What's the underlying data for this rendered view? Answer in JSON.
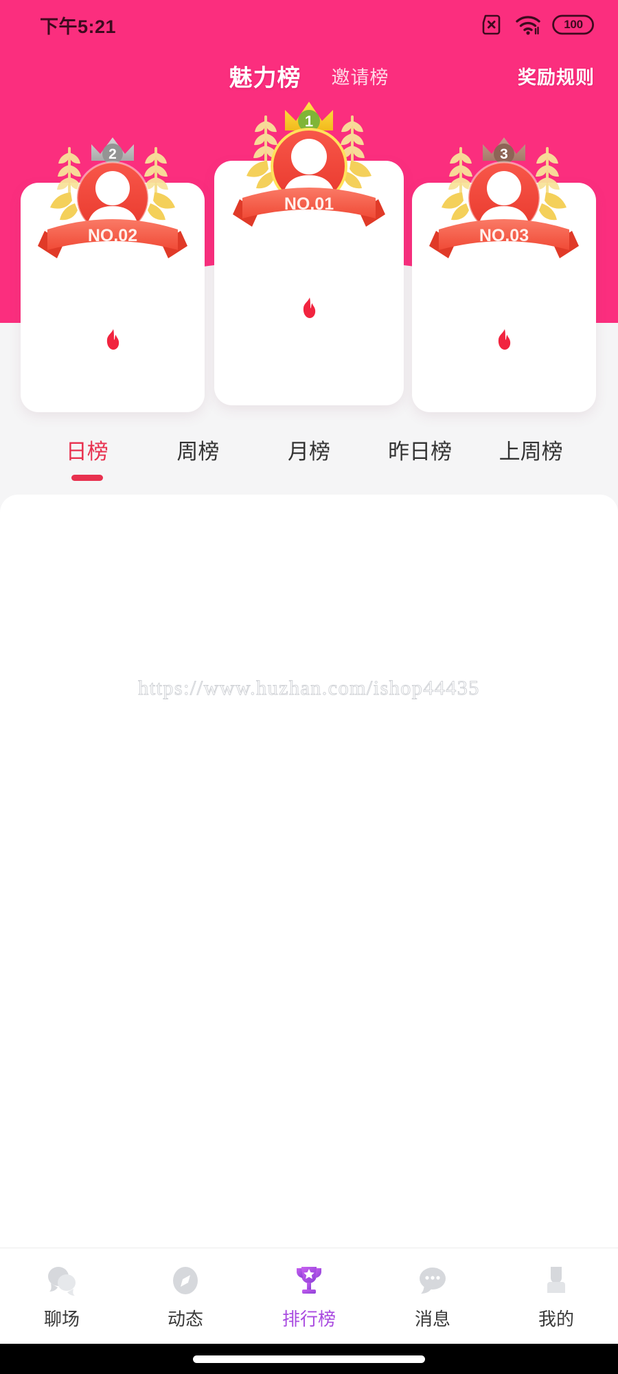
{
  "statusbar": {
    "time": "下午5:21",
    "sim_icon": "sim-card-disabled-icon",
    "wifi_icon": "wifi-icon",
    "battery_icon": "battery-icon",
    "battery_level": "100"
  },
  "header": {
    "tabs": [
      {
        "label": "魅力榜",
        "active": true
      },
      {
        "label": "邀请榜",
        "active": false
      }
    ],
    "rules_label": "奖励规则",
    "background_color": "#FB2E7E"
  },
  "podium": {
    "cards": [
      {
        "rank": "1",
        "ribbon": "NO.01",
        "crown_color": "#F7D228",
        "badge_color": "#7FB537",
        "avatar_ring_color": "#F4483C",
        "flame_icon": "flame-icon"
      },
      {
        "rank": "2",
        "ribbon": "NO.02",
        "crown_color": "#BFBFBF",
        "badge_color": "#8C8C8C",
        "avatar_ring_color": "#F4483C",
        "flame_icon": "flame-icon"
      },
      {
        "rank": "3",
        "ribbon": "NO.03",
        "crown_color": "#B38A7C",
        "badge_color": "#9A6E60",
        "avatar_ring_color": "#F4483C",
        "flame_icon": "flame-icon"
      }
    ]
  },
  "range_tabs": {
    "active_color": "#E8314F",
    "items": [
      {
        "label": "日榜",
        "active": true
      },
      {
        "label": "周榜",
        "active": false
      },
      {
        "label": "月榜",
        "active": false
      },
      {
        "label": "昨日榜",
        "active": false
      },
      {
        "label": "上周榜",
        "active": false
      }
    ]
  },
  "list_panel": {
    "watermark": "https://www.huzhan.com/ishop44435",
    "rows": []
  },
  "bottomnav": {
    "active_color": "#A94BE0",
    "items": [
      {
        "label": "聊场",
        "icon": "chat-rooms-icon",
        "active": false
      },
      {
        "label": "动态",
        "icon": "compass-icon",
        "active": false
      },
      {
        "label": "排行榜",
        "icon": "trophy-icon",
        "active": true
      },
      {
        "label": "消息",
        "icon": "message-icon",
        "active": false
      },
      {
        "label": "我的",
        "icon": "profile-icon",
        "active": false
      }
    ]
  },
  "home_indicator": {
    "label": "home-indicator"
  }
}
